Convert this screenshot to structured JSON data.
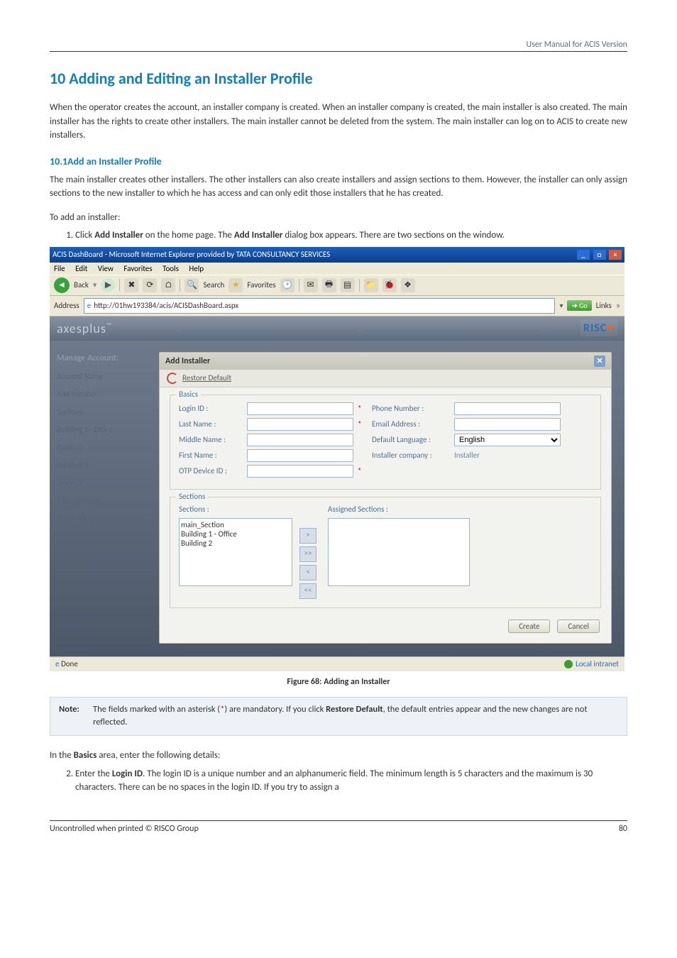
{
  "header": {
    "doc_label": "User Manual for ACIS Version"
  },
  "title": "10 Adding and Editing an Installer Profile",
  "intro": "When the operator creates the account, an installer company is created. When an installer company is created, the main installer is also created. The main installer has the rights to create other installers. The main installer cannot be deleted from the system. The main installer can log on to ACIS to create new installers.",
  "sub1_title": "10.1Add an Installer Profile",
  "sub1_p1": "The main installer creates other installers. The other installers can also create installers and assign sections to them. However, the installer can only assign sections to the new installer to which he has access and can only edit those installers that he has created.",
  "sub1_p2": "To add an installer:",
  "step1_pre": "Click ",
  "step1_b1": "Add Installer",
  "step1_mid": " on the home page. The ",
  "step1_b2": "Add Installer",
  "step1_post": " dialog box appears. There are two sections on the window.",
  "ie": {
    "title": "ACIS DashBoard - Microsoft Internet Explorer provided by TATA CONSULTANCY SERVICES",
    "menu": {
      "file": "File",
      "edit": "Edit",
      "view": "View",
      "favorites": "Favorites",
      "tools": "Tools",
      "help": "Help"
    },
    "toolbar": {
      "back": "Back",
      "search": "Search",
      "favorites": "Favorites"
    },
    "address_label": "Address",
    "address": "http://01hw193384/acis/ACISDashBoard.aspx",
    "go": "Go",
    "links": "Links",
    "status_left": "Done",
    "status_right": "Local intranet"
  },
  "app": {
    "brand": "axesplus",
    "logo_main": "RISC",
    "logo_dot": "●",
    "sidebar": {
      "manage": "Manage Account:",
      "items": [
        "Account Name",
        "Add Installer",
        "Sections",
        "Building 1 - Office",
        "Floor - 0",
        "Building 2",
        "Floor - 0",
        "main_Section",
        "Floor - 1 - 4"
      ]
    },
    "panel_title": "Add Installer",
    "restore": "Restore Default",
    "basics_legend": "Basics",
    "labels": {
      "login": "Login ID :",
      "phone": "Phone Number :",
      "last": "Last Name :",
      "email": "Email Address :",
      "middle": "Middle Name :",
      "lang": "Default Language :",
      "first": "First Name :",
      "company": "Installer company :",
      "otp": "OTP Device ID :"
    },
    "lang_value": "English",
    "company_value": "Installer",
    "sections_legend": "Sections",
    "sections_label": "Sections :",
    "assigned_label": "Assigned Sections :",
    "section_items": [
      "main_Section",
      "Building 1 - Office",
      "Building 2"
    ],
    "btn_create": "Create",
    "btn_cancel": "Cancel"
  },
  "fig_caption": "Figure 68: Adding an Installer",
  "note": {
    "label": "Note:",
    "t1": "The fields marked with an asterisk (",
    "star": "*",
    "t2": ") are mandatory. If you click ",
    "rd": "Restore Default",
    "t3": ", the default entries appear and the new changes are not reflected."
  },
  "after_note": "In the ",
  "after_note_b": "Basics",
  "after_note2": " area, enter the following details:",
  "step2_pre": "Enter the ",
  "step2_b": "Login ID",
  "step2_post": ". The login ID is a unique number and an alphanumeric field. The minimum length is 5 characters and the maximum is 30 characters. There can be no spaces in the login ID. If you try to assign a",
  "footer": {
    "left": "Uncontrolled when printed © RISCO Group",
    "right": "80"
  }
}
